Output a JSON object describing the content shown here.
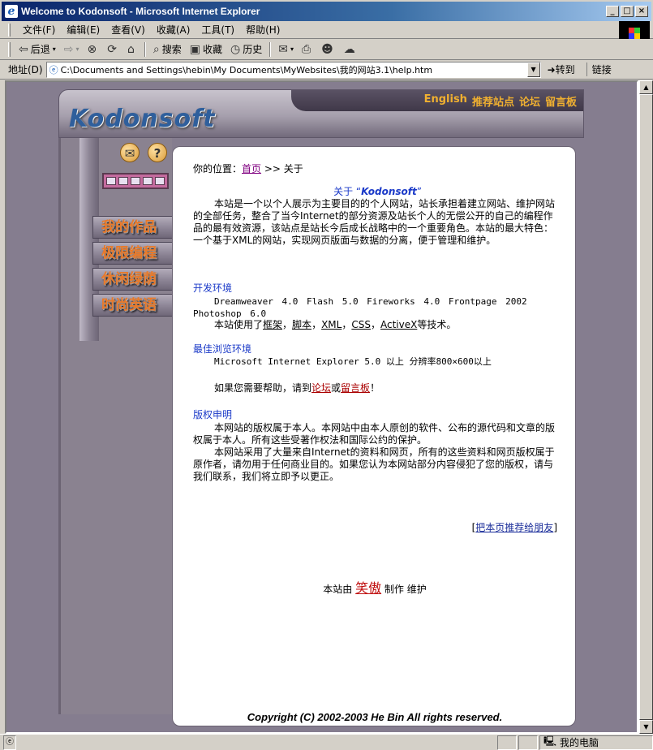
{
  "window": {
    "title": "Welcome to Kodonsoft - Microsoft Internet Explorer"
  },
  "menu": [
    "文件(F)",
    "编辑(E)",
    "查看(V)",
    "收藏(A)",
    "工具(T)",
    "帮助(H)"
  ],
  "toolbar": {
    "back": "后退",
    "search": "搜索",
    "favorites": "收藏",
    "history": "历史"
  },
  "address": {
    "label": "地址(D)",
    "value": "C:\\Documents and Settings\\hebin\\My Documents\\MyWebsites\\我的网站3.1\\help.htm",
    "go": "转到",
    "links": "链接"
  },
  "site": {
    "brand": "Kodonsoft",
    "topnav": [
      "English",
      "推荐站点",
      "论坛",
      "留言板"
    ],
    "leftnav": [
      "我的作品",
      "极限编程",
      "休闲绿荫",
      "时尚英语"
    ],
    "icons": {
      "mail": "envelope-icon",
      "help": "question-icon"
    }
  },
  "content": {
    "breadcrumb_prefix": "你的位置：",
    "breadcrumb_home": "首页",
    "breadcrumb_rest": " >> 关于",
    "about_title_prefix": "关于 “",
    "about_title_name": "Kodonsoft",
    "about_title_suffix": "”",
    "about_body": "本站是一个以个人展示为主要目的的个人网站，站长承担着建立网站、维护网站的全部任务，整合了当今Internet的部分资源及站长个人的无偿公开的自己的编程作品的最有效资源，该站点是站长今后成长战略中的一个重要角色。本站的最大特色：一个基于XML的网站，实现网页版面与数据的分离，便于管理和维护。",
    "dev_heading": "开发环境",
    "dev_tools": "Dreamweaver 4.0   Flash 5.0   Fireworks 4.0   Frontpage 2002 Photoshop 6.0",
    "tech_prefix": "本站使用了",
    "tech_items": [
      "框架",
      "脚本",
      "XML",
      "CSS",
      "ActiveX"
    ],
    "tech_suffix": "等技术。",
    "browse_heading": "最佳浏览环境",
    "browse_text": "Microsoft Internet Explorer 5.0 以上   分辨率800×600以上",
    "help_prefix": "如果您需要帮助，请到",
    "help_forum": "论坛",
    "help_or": "或",
    "help_guestbook": "留言板",
    "help_suffix": "！",
    "copy_heading": "版权申明",
    "copy_p1": "本网站的版权属于本人。本网站中由本人原创的软件、公布的源代码和文章的版权属于本人。所有这些受著作权法和国际公约的保护。",
    "copy_p2": "本网站采用了大量来自Internet的资料和网页，所有的这些资料和网页版权属于原作者，请勿用于任何商业目的。如果您认为本网站部分内容侵犯了您的版权，请与我们联系，我们将立即予以更正。",
    "recommend": "把本页推荐给朋友",
    "maker_prefix": "本站由",
    "maker_name": "笑傲",
    "maker_suffix": "制作 维护",
    "copyright": "Copyright (C) 2002-2003 He Bin  All rights reserved."
  },
  "status": {
    "zone": "我的电脑"
  }
}
